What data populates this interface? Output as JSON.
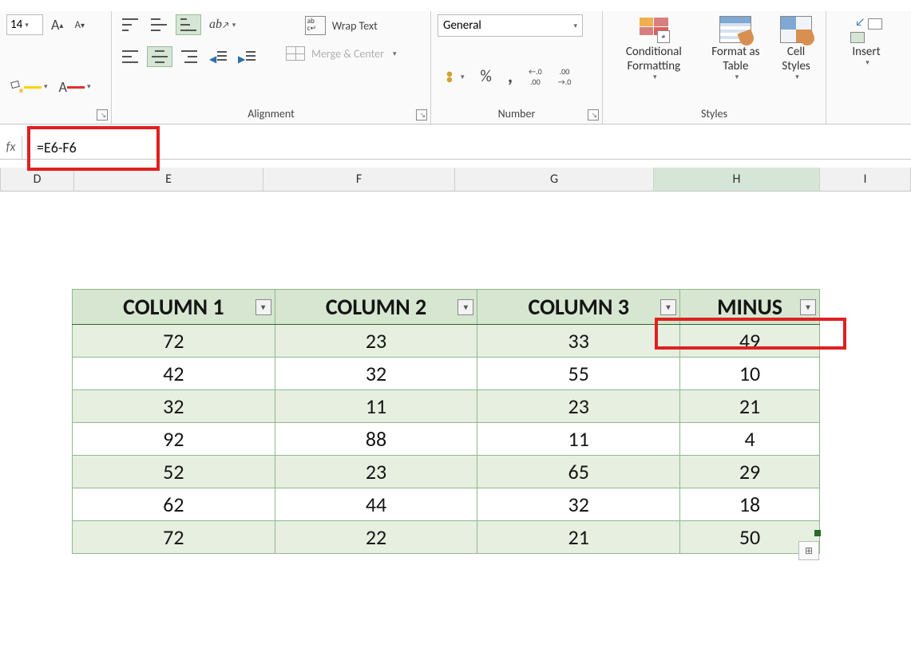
{
  "ribbon": {
    "font": {
      "size": "14",
      "label": ""
    },
    "alignment": {
      "wrap_label": "Wrap Text",
      "merge_label": "Merge & Center",
      "group_label": "Alignment"
    },
    "number": {
      "format": "General",
      "group_label": "Number"
    },
    "styles": {
      "cond_fmt": "Conditional Formatting",
      "fmt_table": "Format as Table",
      "cell_styles": "Cell Styles",
      "group_label": "Styles"
    },
    "cells": {
      "insert": "Insert"
    }
  },
  "formula_bar": {
    "fx": "fx",
    "formula": "=E6-F6"
  },
  "columns": {
    "D": "D",
    "E": "E",
    "F": "F",
    "G": "G",
    "H": "H",
    "I": "I"
  },
  "table": {
    "headers": [
      "COLUMN 1",
      "COLUMN 2",
      "COLUMN 3",
      "MINUS"
    ],
    "rows": [
      [
        72,
        23,
        33,
        49
      ],
      [
        42,
        32,
        55,
        10
      ],
      [
        32,
        11,
        23,
        21
      ],
      [
        92,
        88,
        11,
        4
      ],
      [
        52,
        23,
        65,
        29
      ],
      [
        62,
        44,
        32,
        18
      ],
      [
        72,
        22,
        21,
        50
      ]
    ]
  }
}
